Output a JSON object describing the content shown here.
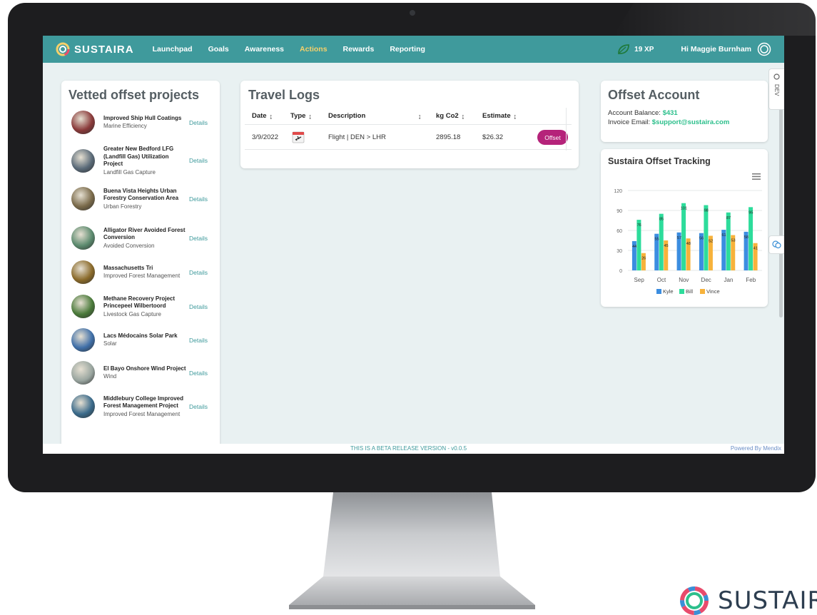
{
  "brand": {
    "name": "SUSTAIRA",
    "footer_logo": "SUSTAIRA"
  },
  "nav": {
    "items": [
      {
        "label": "Launchpad",
        "active": false
      },
      {
        "label": "Goals",
        "active": false
      },
      {
        "label": "Awareness",
        "active": false
      },
      {
        "label": "Actions",
        "active": true
      },
      {
        "label": "Rewards",
        "active": false
      },
      {
        "label": "Reporting",
        "active": false
      }
    ],
    "xp": "19 XP",
    "greeting": "Hi Maggie Burnham",
    "leaf_icon": "leaf-icon",
    "avatar_icon": "avatar-ring-icon"
  },
  "dev_tab": "DEV",
  "vetted": {
    "title": "Vetted offset projects",
    "details_label": "Details",
    "projects": [
      {
        "name": "Improved Ship Hull Coatings",
        "category": "Marine Efficiency",
        "thumb": "#8a3a3a"
      },
      {
        "name": "Greater New Bedford LFG (Landfill Gas) Utilization Project",
        "category": "Landfill Gas Capture",
        "thumb": "#5a6a78"
      },
      {
        "name": "Buena Vista Heights Urban Forestry Conservation Area",
        "category": "Urban Forestry",
        "thumb": "#7a6a4a"
      },
      {
        "name": "Alligator River Avoided Forest Conversion",
        "category": "Avoided Conversion",
        "thumb": "#5b8a6e"
      },
      {
        "name": "Massachusetts Tri",
        "category": "Improved Forest Management",
        "thumb": "#8a6a2a"
      },
      {
        "name": "Methane Recovery Project Princepeel Wilbertoord",
        "category": "Livestock Gas Capture",
        "thumb": "#4a7a3a"
      },
      {
        "name": "Lacs Médocains Solar Park",
        "category": "Solar",
        "thumb": "#3f6fa8"
      },
      {
        "name": "El Bayo Onshore Wind Project",
        "category": "Wind",
        "thumb": "#9aa6a0"
      },
      {
        "name": "Middlebury College Improved Forest Management Project",
        "category": "Improved Forest Management",
        "thumb": "#3a6a8a"
      }
    ]
  },
  "travel": {
    "title": "Travel Logs",
    "columns": [
      "Date",
      "Type",
      "Description",
      "kg Co2",
      "Estimate"
    ],
    "rows": [
      {
        "date": "3/9/2022",
        "type_icon": "calendar-flight-icon",
        "description": "Flight | DEN > LHR",
        "kg_co2": "2895.18",
        "estimate": "$26.32",
        "action": "Offset"
      }
    ]
  },
  "account": {
    "title": "Offset Account",
    "balance_label": "Account Balance:",
    "balance_value": "$431",
    "email_label": "Invoice Email:",
    "email_value": "$support@sustaira.com"
  },
  "tracking": {
    "title": "Sustaira Offset Tracking",
    "menu_icon": "hamburger-menu-icon"
  },
  "chart_data": {
    "type": "bar",
    "categories": [
      "Sep",
      "Oct",
      "Nov",
      "Dec",
      "Jan",
      "Feb"
    ],
    "series": [
      {
        "name": "Kyle",
        "color": "#3b8de0",
        "values": [
          44,
          55,
          57,
          56,
          61,
          58
        ]
      },
      {
        "name": "Bill",
        "color": "#2ddc9b",
        "values": [
          76,
          85,
          101,
          98,
          87,
          95
        ]
      },
      {
        "name": "Vince",
        "color": "#f7b23b",
        "values": [
          26,
          45,
          48,
          52,
          53,
          41
        ]
      }
    ],
    "yticks": [
      0,
      30,
      60,
      90,
      120
    ],
    "ylim": [
      0,
      120
    ],
    "grid": true,
    "legend": "bottom"
  },
  "footer": {
    "beta": "THIS IS A BETA RELEASE VERSION - v0.0.5",
    "powered": "Powered By Mendix"
  }
}
